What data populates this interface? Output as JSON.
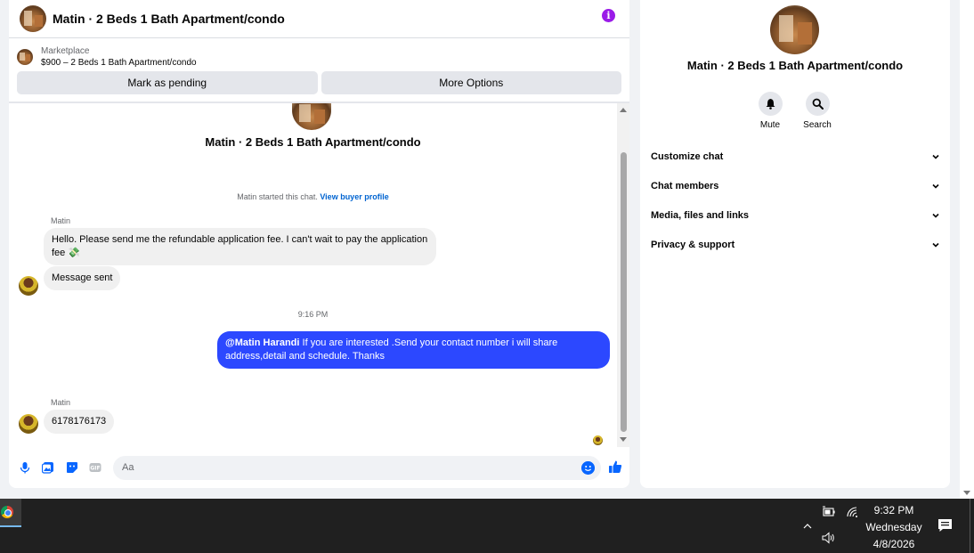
{
  "chat": {
    "title": "Matin · 2 Beds 1 Bath Apartment/condo",
    "marketplace_label": "Marketplace",
    "listing": "$900 – 2 Beds 1 Bath Apartment/condo",
    "mark_pending": "Mark as pending",
    "more_options": "More Options",
    "hero_title": "Matin · 2 Beds 1 Bath Apartment/condo",
    "started_text": "Matin started this chat. ",
    "buyer_profile_link": "View buyer profile",
    "messages": [
      {
        "sender": "Matin",
        "text": "Hello. Please send me the refundable application fee. I can't wait to pay the application fee 💸"
      },
      {
        "text": "Message sent"
      },
      {
        "timestamp": "9:16 PM"
      },
      {
        "mention": "@Matin Harandi",
        "text": "  If you are interested .Send your contact number i will share address,detail and schedule. Thanks"
      },
      {
        "sender": "Matin",
        "text": "6178176173"
      }
    ],
    "composer_placeholder": "Aa"
  },
  "side": {
    "title": "Matin · 2 Beds 1 Bath Apartment/condo",
    "mute_label": "Mute",
    "search_label": "Search",
    "menu": [
      "Customize chat",
      "Chat members",
      "Media, files and links",
      "Privacy & support"
    ]
  },
  "taskbar": {
    "time": "9:32 PM",
    "day": "Wednesday",
    "date": "4/8/2026"
  },
  "colors": {
    "accent": "#0866ff",
    "outgoing_bubble": "#2c48ff",
    "info": "#9a1be8"
  }
}
